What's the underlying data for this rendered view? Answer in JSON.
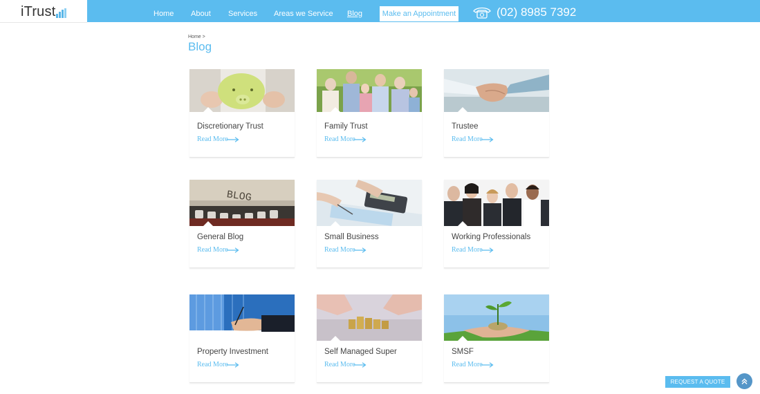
{
  "header": {
    "logo_text": "iTrust",
    "nav": [
      {
        "label": "Home"
      },
      {
        "label": "About"
      },
      {
        "label": "Services"
      },
      {
        "label": "Areas we Service"
      },
      {
        "label": "Blog"
      }
    ],
    "appointment_label": "Make an Appointment",
    "phone": "(02) 8985 7392",
    "phone_icon": "phone-icon"
  },
  "breadcrumb": "Home >",
  "page_title": "Blog",
  "cards": [
    {
      "title": "Discretionary Trust",
      "link": "Read More",
      "image": "piggy-bank-image"
    },
    {
      "title": "Family Trust",
      "link": "Read More",
      "image": "family-image"
    },
    {
      "title": "Trustee",
      "link": "Read More",
      "image": "handshake-image"
    },
    {
      "title": "General Blog",
      "link": "Read More",
      "image": "typewriter-blog-image"
    },
    {
      "title": "Small Business",
      "link": "Read More",
      "image": "calculator-image"
    },
    {
      "title": "Working Professionals",
      "link": "Read More",
      "image": "professionals-image"
    },
    {
      "title": "Property Investment",
      "link": "Read More",
      "image": "building-signing-image"
    },
    {
      "title": "Self Managed Super",
      "link": "Read More",
      "image": "coins-image"
    },
    {
      "title": "SMSF",
      "link": "Read More",
      "image": "plant-coins-image"
    }
  ],
  "request_quote_label": "REQUEST A QUOTE",
  "colors": {
    "accent": "#5bbcef",
    "back_to_top": "#5596c8"
  }
}
